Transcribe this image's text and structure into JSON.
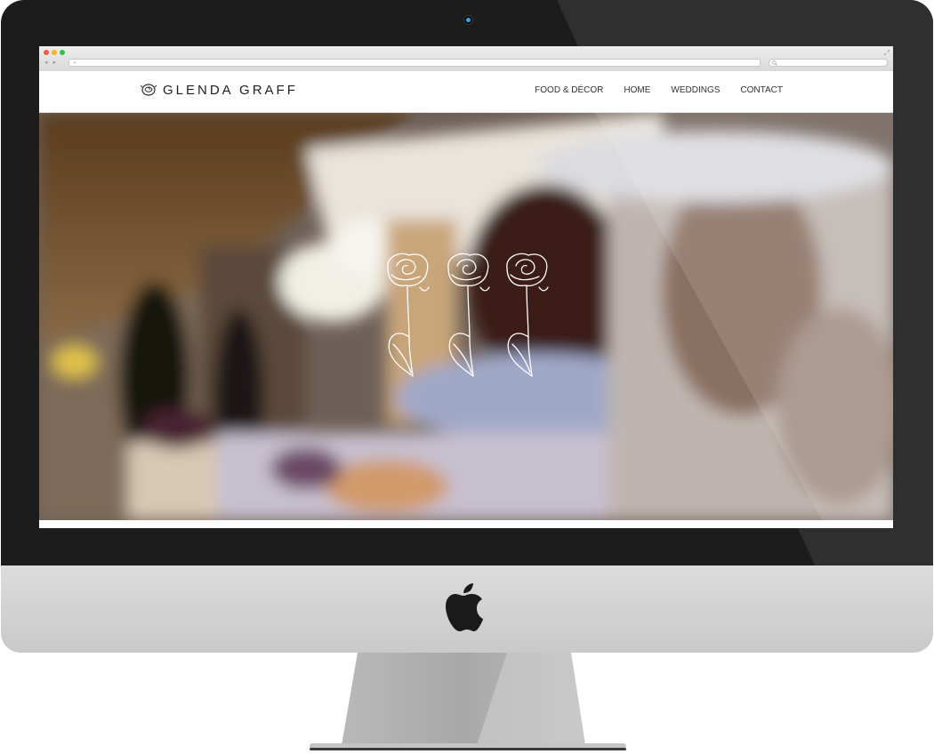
{
  "site": {
    "logo_text": "GLENDA GRAFF",
    "logo_icon": "rose-icon"
  },
  "nav": {
    "items": [
      {
        "label": "FOOD & DÉCOR"
      },
      {
        "label": "HOME"
      },
      {
        "label": "WEDDINGS"
      },
      {
        "label": "CONTACT"
      }
    ]
  },
  "browser": {
    "url_placeholder": "+",
    "nav_arrows": "◂ ▸"
  },
  "hero": {
    "decoration": "three-roses-illustration"
  },
  "device": {
    "logo": "apple-logo-icon"
  },
  "colors": {
    "bezel": "#1c1c1c",
    "chin": "#d4d4d4",
    "camera_light": "#3aa8e0",
    "nav_text": "#333333"
  }
}
